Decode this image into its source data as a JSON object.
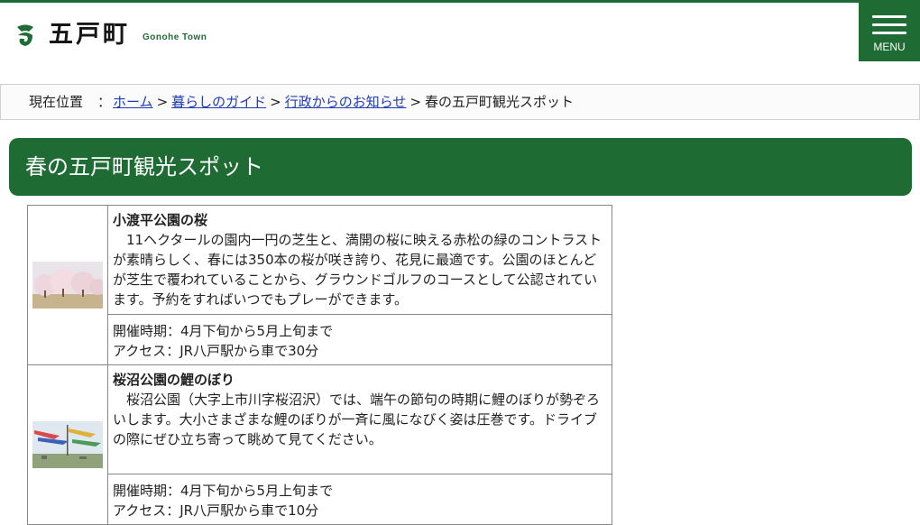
{
  "header": {
    "logo_text": "五戸町",
    "logo_sub": "Gonohe Town",
    "menu_label": "MENU",
    "brand_color": "#1e6b34"
  },
  "breadcrumb": {
    "here_label": "現在位置",
    "colon": "：",
    "items": [
      "ホーム",
      "暮らしのガイド",
      "行政からのお知らせ"
    ],
    "separator": ">",
    "current": "春の五戸町観光スポット"
  },
  "page": {
    "title": "春の五戸町観光スポット"
  },
  "spots": [
    {
      "name": "小渡平公園の桜",
      "text": "11ヘクタールの園内一円の芝生と、満開の桜に映える赤松の緑のコントラストが素晴らしく、春には350本の桜が咲き誇り、花見に最適です。公園のほとんどが芝生で覆われていることから、グラウンドゴルフのコースとして公認されています。予約をすればいつでもプレーができます。",
      "period": "開催時期：4月下旬から5月上旬まで",
      "access": "アクセス：JR八戸駅から車で30分",
      "photo_icon": "cherry-blossom-photo"
    },
    {
      "name": "桜沼公園の鯉のぼり",
      "text": "桜沼公園（大字上市川字桜沼沢）では、端午の節句の時期に鯉のぼりが勢ぞろいします。大小さまざまな鯉のぼりが一斉に風になびく姿は圧巻です。ドライブの際にぜひ立ち寄って眺めて見てください。",
      "period": "開催時期：4月下旬から5月上旬まで",
      "access": "アクセス：JR八戸駅から車で10分",
      "photo_icon": "carp-streamers-photo"
    }
  ]
}
